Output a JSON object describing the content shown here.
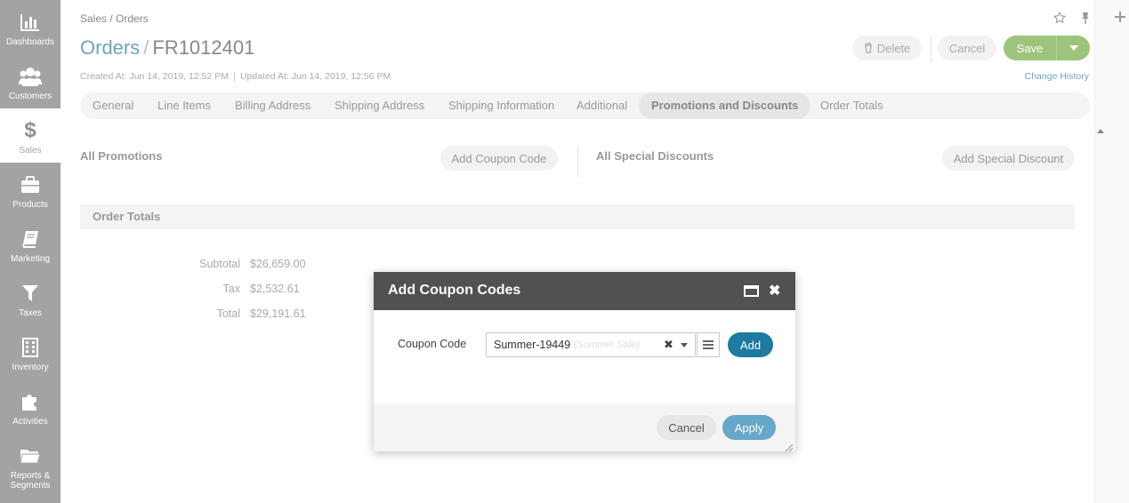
{
  "sidebar": {
    "items": [
      {
        "label": "Dashboards",
        "icon": "bar-chart-icon"
      },
      {
        "label": "Customers",
        "icon": "users-icon"
      },
      {
        "label": "Sales",
        "icon": "dollar-icon"
      },
      {
        "label": "Products",
        "icon": "briefcase-icon"
      },
      {
        "label": "Marketing",
        "icon": "book-icon"
      },
      {
        "label": "Taxes",
        "icon": "filter-icon"
      },
      {
        "label": "Inventory",
        "icon": "building-icon"
      },
      {
        "label": "Activities",
        "icon": "puzzle-icon"
      },
      {
        "label": "Reports &\nSegments",
        "icon": "folder-icon"
      }
    ],
    "active": "Sales"
  },
  "header": {
    "breadcrumb": "Sales / Orders",
    "title_main": "Orders",
    "title_sep": "/",
    "title_id": "FR1012401",
    "created": "Created At: Jun 14, 2019, 12:52 PM",
    "updated": "Updated At: Jun 14, 2019, 12:56 PM",
    "delete_label": "Delete",
    "cancel_label": "Cancel",
    "save_label": "Save",
    "change_history": "Change History"
  },
  "tabs": [
    {
      "label": "General"
    },
    {
      "label": "Line Items"
    },
    {
      "label": "Billing Address"
    },
    {
      "label": "Shipping Address"
    },
    {
      "label": "Shipping Information"
    },
    {
      "label": "Additional"
    },
    {
      "label": "Promotions and Discounts",
      "active": true
    },
    {
      "label": "Order Totals"
    }
  ],
  "promotions": {
    "title": "All Promotions",
    "add_coupon": "Add Coupon Code",
    "special_title": "All Special Discounts",
    "add_special": "Add Special Discount"
  },
  "order_totals": {
    "title": "Order Totals",
    "rows": [
      {
        "label": "Subtotal",
        "value": "$26,659.00"
      },
      {
        "label": "Tax",
        "value": "$2,532.61"
      },
      {
        "label": "Total",
        "value": "$29,191.61"
      }
    ]
  },
  "modal": {
    "title": "Add Coupon Codes",
    "field_label": "Coupon Code",
    "value": "Summer-19449",
    "hint": "(Summer Sale)",
    "add_label": "Add",
    "cancel_label": "Cancel",
    "apply_label": "Apply"
  },
  "colors": {
    "accent": "#6ea3c4",
    "save": "#9cc57b",
    "modal_header": "#515151",
    "add_button": "#1d7aa0",
    "apply_button": "#67a7c7",
    "sidebar": "#a3a3a3"
  }
}
